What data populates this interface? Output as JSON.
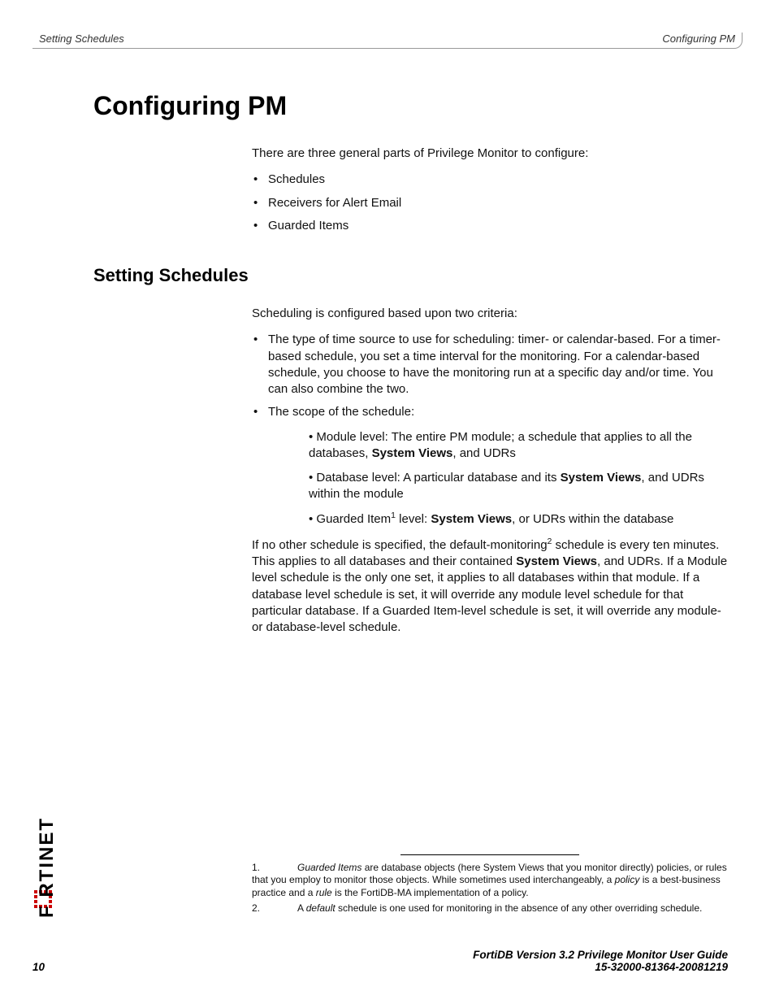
{
  "header": {
    "left": "Setting Schedules",
    "right": "Configuring PM"
  },
  "h1": "Configuring PM",
  "intro": "There are three general parts of Privilege Monitor to configure:",
  "intro_bullets": [
    "Schedules",
    "Receivers for Alert Email",
    "Guarded Items"
  ],
  "h2": "Setting Schedules",
  "sched_intro": "Scheduling is configured based upon two criteria:",
  "sched_bullet1": "The type of time source to use for scheduling: timer- or calendar-based. For a timer-based schedule, you set a time interval for the monitoring. For a calendar-based schedule, you choose to have the monitoring run at a specific day and/or time. You can also combine the two.",
  "sched_bullet2": "The scope of the schedule:",
  "scope": {
    "module_a": "• Module level: The entire PM module; a schedule that applies to all the databases, ",
    "module_b": "System Views",
    "module_c": ", and UDRs",
    "db_a": "• Database level: A particular database and its ",
    "db_b": "System Views",
    "db_c": ", and UDRs within the module",
    "gi_a": "• Guarded Item",
    "gi_sup": "1",
    "gi_b": " level: ",
    "gi_c": "System Views",
    "gi_d": ", or UDRs within the database"
  },
  "paragraph": {
    "a": "If no other schedule is specified, the default-monitoring",
    "sup": "2",
    "b": " schedule is every ten minutes. This applies to all databases and their contained ",
    "c": "System Views",
    "d": ", and UDRs. If a Module level schedule is the only one set, it applies to all databases within that module. If a database level schedule is set, it will override any module level schedule for that particular database. If a Guarded Item-level schedule is set, it will override any module- or database-level schedule."
  },
  "footnotes": {
    "n1": "1.",
    "f1a": "Guarded Items",
    "f1b": " are database objects (here System Views that you monitor directly) policies, or rules that you employ to monitor those objects. While sometimes used interchangeably, a ",
    "f1c": "policy",
    "f1d": " is a best-business practice and a ",
    "f1e": "rule",
    "f1f": " is the FortiDB-MA implementation of a policy.",
    "n2": "2.",
    "f2a": "A ",
    "f2b": "default",
    "f2c": " schedule is one used for monitoring in the absence of any other overriding schedule."
  },
  "footer": {
    "page": "10",
    "line1": "FortiDB Version 3.2 Privilege Monitor  User Guide",
    "line2": "15-32000-81364-20081219"
  },
  "logo_text": "F   RTINET"
}
